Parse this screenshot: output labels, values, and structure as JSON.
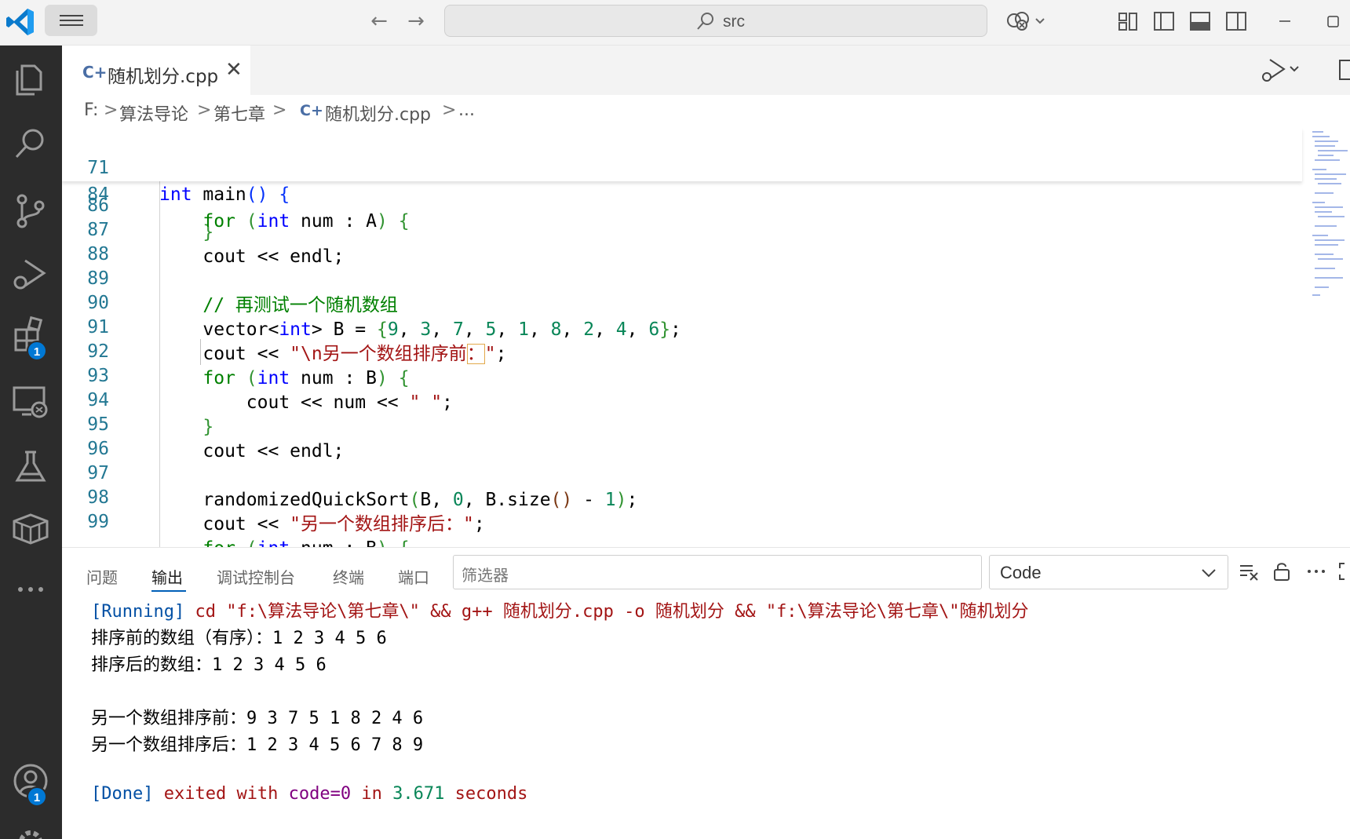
{
  "titlebar": {
    "search_text": "src"
  },
  "tab": {
    "icon": "C+",
    "label": "随机划分.cpp",
    "close": "✕"
  },
  "breadcrumb": {
    "drive": "F:",
    "folder1": "算法导论",
    "folder2": "第七章",
    "file": "随机划分.cpp",
    "more": "...",
    "sep": ">"
  },
  "editor": {
    "sticky": [
      {
        "ln": "71",
        "code": "int main() {"
      },
      {
        "ln": "84",
        "code": "    for (int num : A) {"
      }
    ],
    "lines": [
      {
        "ln": "86",
        "code": "    }"
      },
      {
        "ln": "87",
        "code": "    cout << endl;"
      },
      {
        "ln": "88",
        "code": ""
      },
      {
        "ln": "89",
        "code": "    // 再测试一个随机数组"
      },
      {
        "ln": "90",
        "code": "    vector<int> B = {9, 3, 7, 5, 1, 8, 2, 4, 6};"
      },
      {
        "ln": "91",
        "code": "    cout << \"\\n另一个数组排序前：\";"
      },
      {
        "ln": "92",
        "code": "    for (int num : B) {"
      },
      {
        "ln": "93",
        "code": "        cout << num << \" \";"
      },
      {
        "ln": "94",
        "code": "    }"
      },
      {
        "ln": "95",
        "code": "    cout << endl;"
      },
      {
        "ln": "96",
        "code": ""
      },
      {
        "ln": "97",
        "code": "    randomizedQuickSort(B, 0, B.size() - 1);"
      },
      {
        "ln": "98",
        "code": "    cout << \"另一个数组排序后：\";"
      },
      {
        "ln": "99",
        "code": "    for (int num : B) {"
      }
    ]
  },
  "panel": {
    "tabs": [
      "问题",
      "输出",
      "调试控制台",
      "终端",
      "端口"
    ],
    "active_tab": "输出",
    "filter_placeholder": "筛选器",
    "channel": "Code",
    "output": {
      "running_tag": "[Running]",
      "running_cmd": " cd \"f:\\算法导论\\第七章\\\" && g++ 随机划分.cpp -o 随机划分 && \"f:\\算法导论\\第七章\\\"随机划分",
      "line1": "排序前的数组（有序）：1 2 3 4 5 6",
      "line2": "排序后的数组：1 2 3 4 5 6",
      "line3": "另一个数组排序前：9 3 7 5 1 8 2 4 6",
      "line4": "另一个数组排序后：1 2 3 4 5 6 7 8 9",
      "done_tag": "[Done]",
      "done_text1": " exited with ",
      "done_code": "code=0",
      "done_text2": " in ",
      "done_time": "3.671",
      "done_text3": " seconds"
    }
  },
  "activity_badges": {
    "extensions": "1",
    "accounts": "1"
  },
  "colors": {
    "accent": "#0078d4",
    "keyword": "#0000ff",
    "string": "#a31515",
    "number": "#098658",
    "comment": "#008000"
  }
}
